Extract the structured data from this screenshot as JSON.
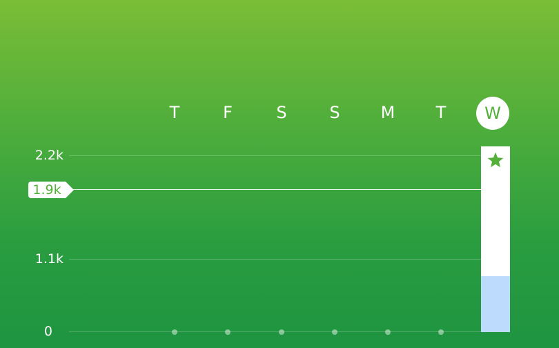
{
  "days": [
    "T",
    "F",
    "S",
    "S",
    "M",
    "T",
    "W"
  ],
  "active_day_index": 6,
  "y_axis": {
    "labels": [
      "2.2k",
      "1.1k",
      "0"
    ],
    "max": 2200
  },
  "goal": {
    "label": "1.9k",
    "value": 1900
  },
  "today_bar": {
    "fraction_of_max": 1.0,
    "inner_fill_fraction_of_max": 0.3,
    "icon": "star-icon"
  },
  "colors": {
    "accent": "#55b03a",
    "bar_fill": "#ffffff",
    "bar_inner": "#bcdbfd"
  }
}
